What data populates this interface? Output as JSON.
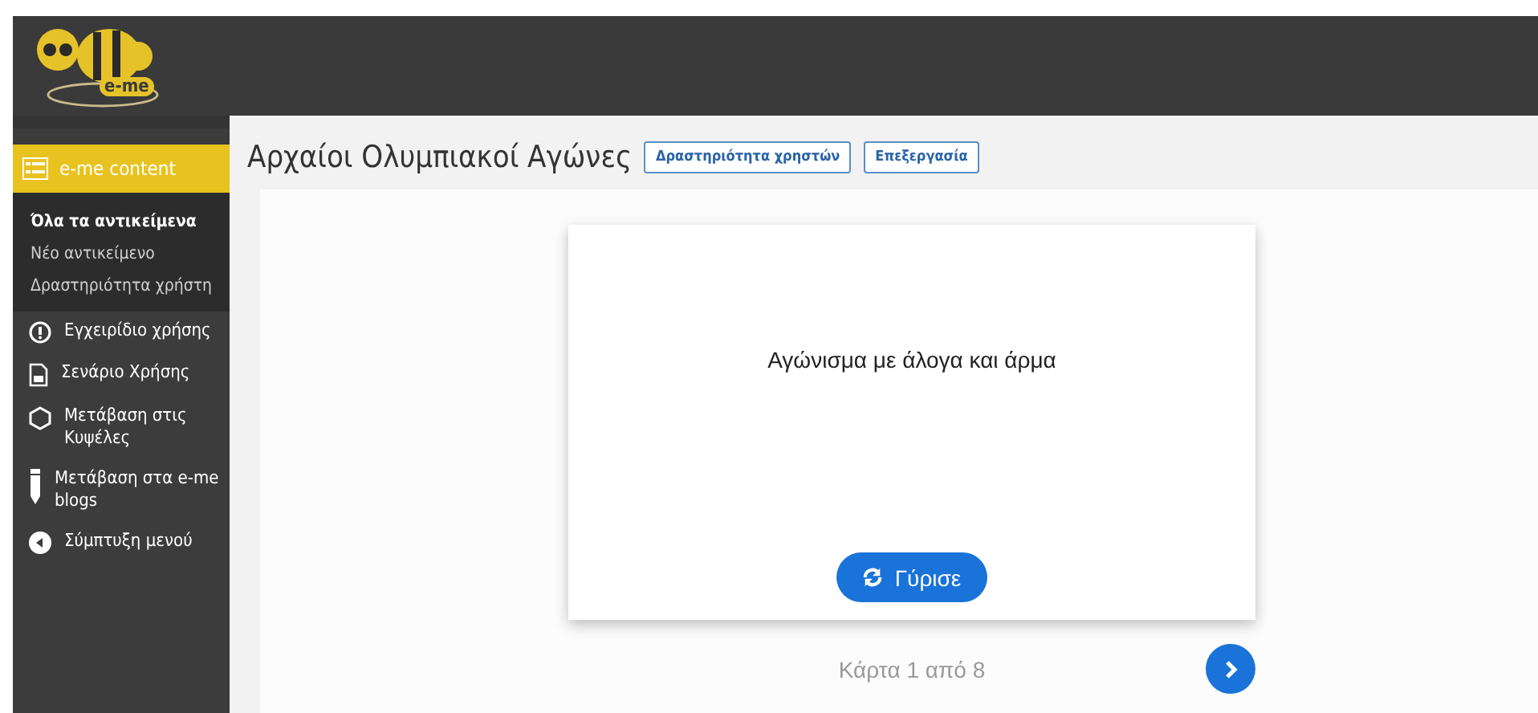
{
  "logo": {
    "text": "e-me"
  },
  "sidebar": {
    "active_section": {
      "label": "e-me content"
    },
    "submenu": [
      {
        "label": "Όλα τα αντικείμενα",
        "selected": true
      },
      {
        "label": "Νέο αντικείμενο",
        "selected": false
      },
      {
        "label": "Δραστηριότητα χρήστη",
        "selected": false
      }
    ],
    "items": [
      {
        "kind": "info",
        "label": "Εγχειρίδιο χρήσης"
      },
      {
        "kind": "document",
        "label": "Σενάριο Χρήσης"
      },
      {
        "kind": "hexagon",
        "label": "Μετάβαση στις Κυψέλες"
      },
      {
        "kind": "pencil",
        "label": "Μετάβαση στα e-me blogs"
      },
      {
        "kind": "collapse",
        "label": "Σύμπτυξη μενού"
      }
    ]
  },
  "page": {
    "title": "Αρχαίοι Ολυμπιακοί Αγώνες",
    "buttons": [
      "Δραστηριότητα χρηστών",
      "Επεξεργασία"
    ]
  },
  "card": {
    "text": "Αγώνισμα με άλογα και άρμα",
    "flip_button": "Γύρισε"
  },
  "pager": {
    "text": "Κάρτα 1 από 8"
  }
}
